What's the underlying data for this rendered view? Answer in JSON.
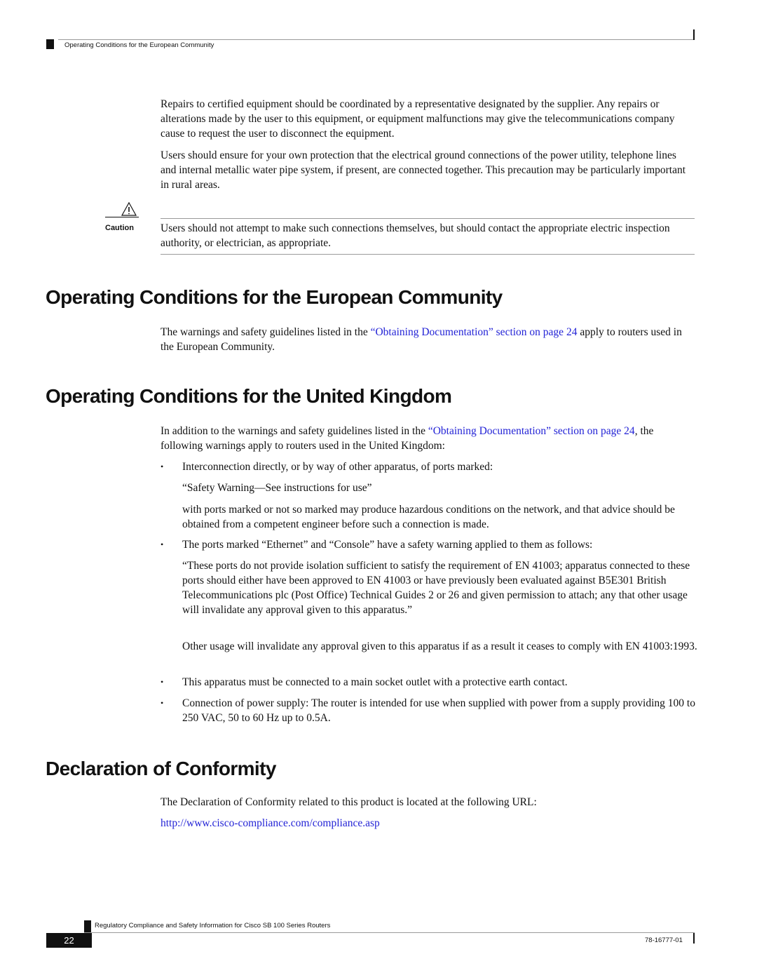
{
  "header": {
    "running_title": "Operating Conditions for the European Community"
  },
  "intro": {
    "paragraphs": [
      "Repairs to certified equipment should be coordinated by a representative designated by the supplier. Any repairs or alterations made by the user to this equipment, or equipment malfunctions may give the telecommunications company cause to request the user to disconnect the equipment.",
      "Users should ensure for your own protection that the electrical ground connections of the power utility, telephone lines and internal metallic water pipe system, if present, are connected together. This precaution may be particularly important in rural areas."
    ]
  },
  "caution": {
    "icon": "warning-triangle-icon",
    "label": "Caution",
    "text": "Users should not attempt to make such connections themselves, but should contact the appropriate electric inspection authority, or electrician, as appropriate."
  },
  "sections": {
    "european": {
      "heading": "Operating Conditions for the European Community",
      "text_before": "The warnings and safety guidelines listed in the ",
      "link": "“Obtaining Documentation” section on page 24",
      "text_after": " apply to routers used in the European Community."
    },
    "uk": {
      "heading": "Operating Conditions for the United Kingdom",
      "text_before": "In addition to the warnings and safety guidelines listed in the ",
      "link": "“Obtaining Documentation” section on page 24",
      "text_after": ", the following warnings apply to routers used in the United Kingdom:",
      "bullets": [
        {
          "text": "Interconnection directly, or by way of other apparatus, of ports marked:",
          "sub": [
            "“Safety Warning—See instructions for use”",
            "with ports marked or not so marked may produce hazardous conditions on the network, and that advice should be obtained from a competent engineer before such a connection is made."
          ]
        },
        {
          "text": "The ports marked “Ethernet” and “Console” have a safety warning applied to them as follows:",
          "sub": [
            "“These ports do not provide isolation sufficient to satisfy the requirement of EN 41003; apparatus connected to these ports should either have been approved to EN 41003 or have previously been evaluated against B5E301 British Telecommunications plc (Post Office) Technical Guides 2 or 26 and given permission to attach; any that other usage will invalidate any approval given to this apparatus.”",
            "Other usage will invalidate any approval given to this apparatus if as a result it ceases to comply with EN 41003:1993."
          ]
        },
        {
          "text": "This apparatus must be connected to a main socket outlet with a protective earth contact."
        },
        {
          "text": "Connection of power supply: The router is intended for use when supplied with power from a supply providing 100 to 250 VAC, 50 to 60 Hz up to 0.5A."
        }
      ]
    },
    "conformity": {
      "heading": "Declaration of Conformity",
      "text": "The Declaration of Conformity related to this product is located at the following URL:",
      "url": "http://www.cisco-compliance.com/compliance.asp"
    }
  },
  "footer": {
    "title": "Regulatory Compliance and Safety Information for Cisco SB 100 Series Routers",
    "page_number": "22",
    "doc_number": "78-16777-01"
  },
  "colors": {
    "link": "#2323d6",
    "text": "#111111",
    "rule": "#9a9a9a"
  }
}
